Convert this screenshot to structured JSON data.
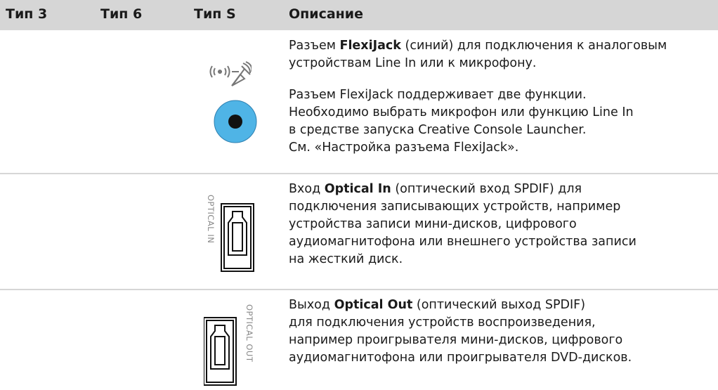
{
  "columns": {
    "type3": "Тип 3",
    "type6": "Тип 6",
    "typeS": "Тип S",
    "description": "Описание"
  },
  "rows": [
    {
      "icon": "flexijack-mic-linein-icon",
      "jack_color": "#4fb4e6",
      "para1_prefix": "Разъем ",
      "para1_bold": "FlexiJack",
      "para1_rest": " (синий) для подключения к аналоговым устройствам Line In или к микрофону.",
      "para2_lines": [
        "Разъем FlexiJack поддерживает две функции.",
        "Необходимо выбрать микрофон или функцию Line In",
        "в средстве запуска Creative Console Launcher.",
        "См. «Настройка разъема FlexiJack»."
      ]
    },
    {
      "icon": "optical-in-icon",
      "icon_label": "OPTICAL IN",
      "prefix": "Вход ",
      "bold": "Optical In",
      "rest_first": " (оптический вход SPDIF) для",
      "rest_lines": [
        "подключения записывающих устройств, например",
        "устройства записи мини-дисков, цифрового",
        "аудиомагнитофона или внешнего устройства записи",
        "на жесткий диск."
      ]
    },
    {
      "icon": "optical-out-icon",
      "icon_label": "OPTICAL OUT",
      "prefix": "Выход ",
      "bold": "Optical Out",
      "rest_first": " (оптический выход SPDIF)",
      "rest_lines": [
        "для подключения устройств воспроизведения,",
        "например проигрывателя мини-дисков, цифрового",
        "аудиомагнитофона или проигрывателя DVD-дисков."
      ]
    }
  ]
}
